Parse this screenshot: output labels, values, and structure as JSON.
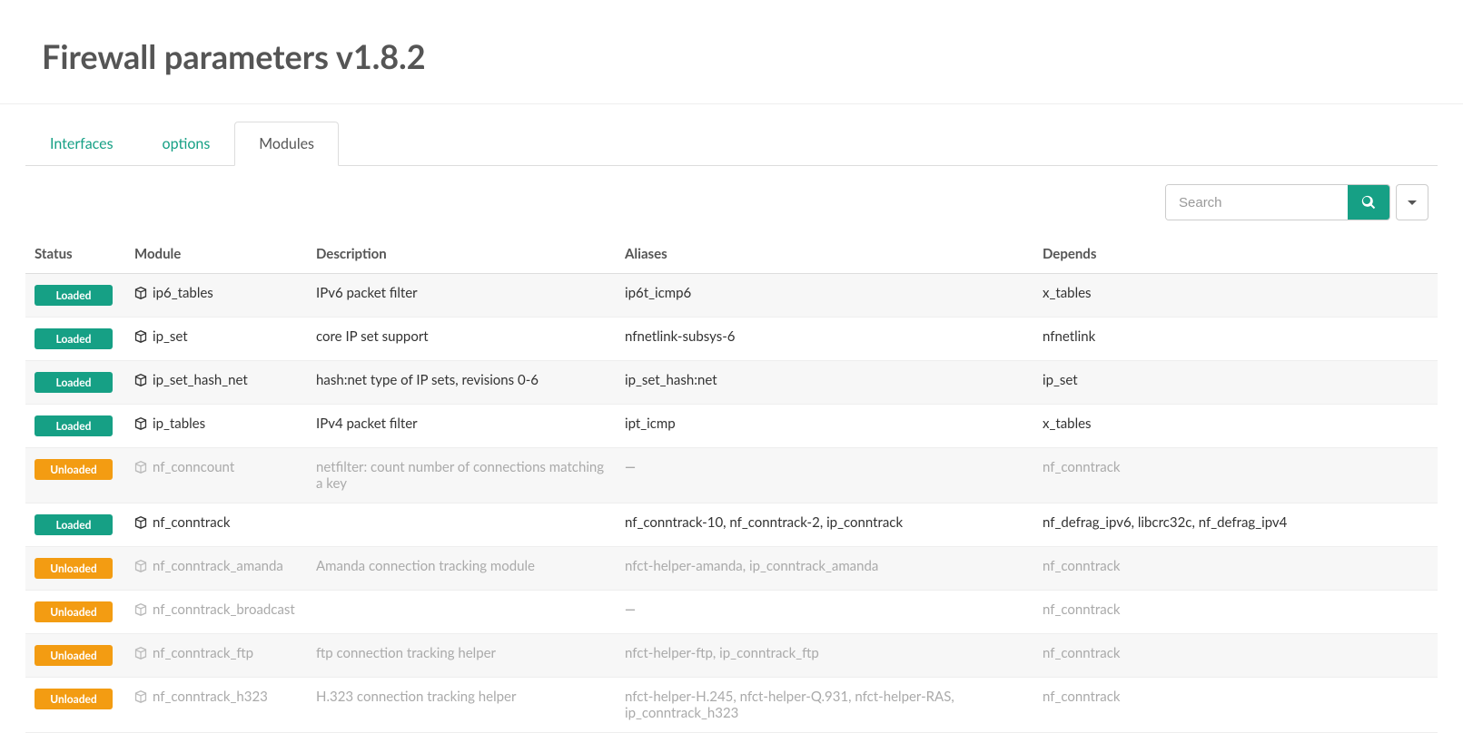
{
  "header": {
    "title": "Firewall parameters v1.8.2"
  },
  "tabs": [
    {
      "label": "Interfaces",
      "active": false
    },
    {
      "label": "options",
      "active": false
    },
    {
      "label": "Modules",
      "active": true
    }
  ],
  "search": {
    "placeholder": "Search"
  },
  "table": {
    "columns": [
      "Status",
      "Module",
      "Description",
      "Aliases",
      "Depends"
    ],
    "status_labels": {
      "loaded": "Loaded",
      "unloaded": "Unloaded"
    },
    "rows": [
      {
        "status": "loaded",
        "module": "ip6_tables",
        "description": "IPv6 packet filter",
        "aliases": "ip6t_icmp6",
        "depends": "x_tables"
      },
      {
        "status": "loaded",
        "module": "ip_set",
        "description": "core IP set support",
        "aliases": "nfnetlink-subsys-6",
        "depends": "nfnetlink"
      },
      {
        "status": "loaded",
        "module": "ip_set_hash_net",
        "description": "hash:net type of IP sets, revisions 0-6",
        "aliases": "ip_set_hash:net",
        "depends": "ip_set"
      },
      {
        "status": "loaded",
        "module": "ip_tables",
        "description": "IPv4 packet filter",
        "aliases": "ipt_icmp",
        "depends": "x_tables"
      },
      {
        "status": "unloaded",
        "module": "nf_conncount",
        "description": "netfilter: count number of connections matching a key",
        "aliases": "—",
        "depends": "nf_conntrack"
      },
      {
        "status": "loaded",
        "module": "nf_conntrack",
        "description": "",
        "aliases": "nf_conntrack-10, nf_conntrack-2, ip_conntrack",
        "depends": "nf_defrag_ipv6, libcrc32c, nf_defrag_ipv4"
      },
      {
        "status": "unloaded",
        "module": "nf_conntrack_amanda",
        "description": "Amanda connection tracking module",
        "aliases": "nfct-helper-amanda, ip_conntrack_amanda",
        "depends": "nf_conntrack"
      },
      {
        "status": "unloaded",
        "module": "nf_conntrack_broadcast",
        "description": "",
        "aliases": "—",
        "depends": "nf_conntrack"
      },
      {
        "status": "unloaded",
        "module": "nf_conntrack_ftp",
        "description": "ftp connection tracking helper",
        "aliases": "nfct-helper-ftp, ip_conntrack_ftp",
        "depends": "nf_conntrack"
      },
      {
        "status": "unloaded",
        "module": "nf_conntrack_h323",
        "description": "H.323 connection tracking helper",
        "aliases": "nfct-helper-H.245, nfct-helper-Q.931, nfct-helper-RAS, ip_conntrack_h323",
        "depends": "nf_conntrack"
      }
    ]
  }
}
